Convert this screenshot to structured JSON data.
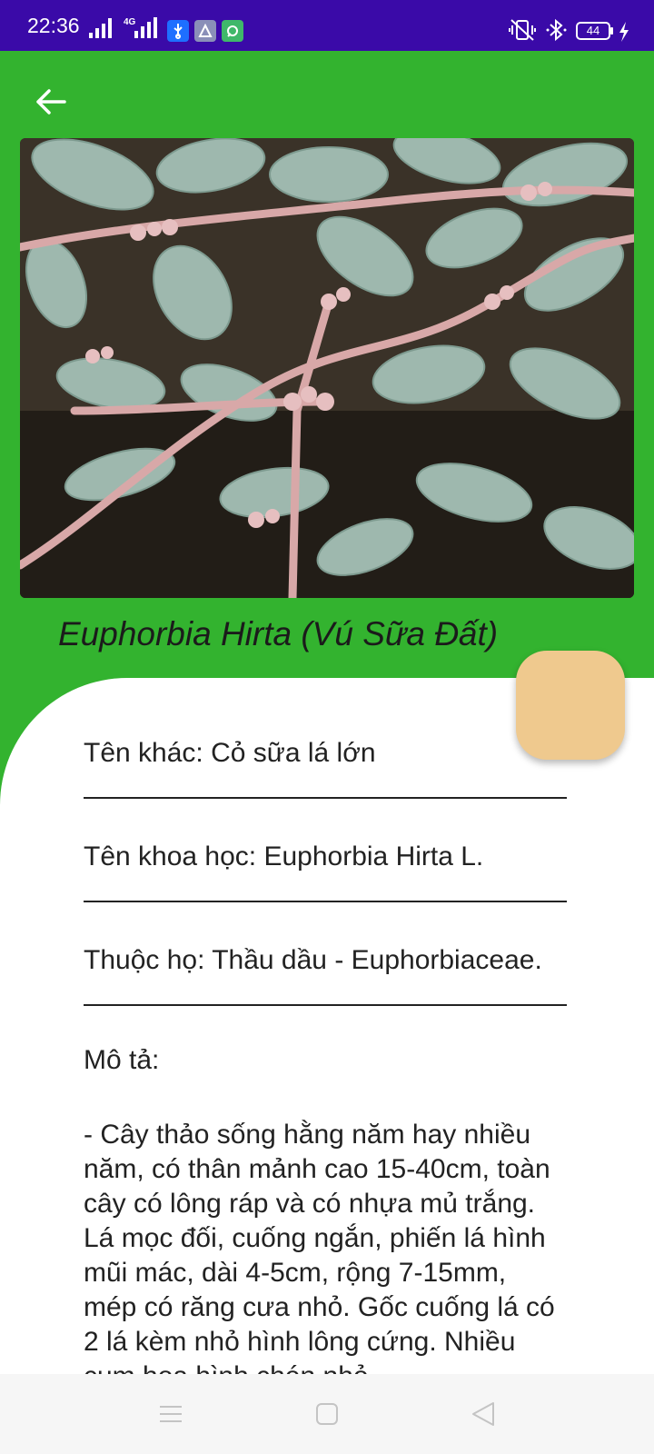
{
  "status_bar": {
    "time": "22:36",
    "network_label": "4G",
    "battery_level": "44",
    "colors": {
      "background": "#3a0aa8",
      "usb_badge": "#1e6fff",
      "app_badge_1": "#8a8fb8",
      "app_badge_2": "#3fb86a"
    },
    "icons": [
      "signal-icon",
      "signal-4g-icon",
      "usb-icon",
      "app-icon",
      "app-icon",
      "vibrate-icon",
      "bluetooth-icon",
      "battery-icon",
      "charging-icon"
    ]
  },
  "header": {
    "back_icon": "arrow-left-icon",
    "plant_title": "Euphorbia Hirta (Vú Sữa Đất)",
    "colors": {
      "background": "#33b32f"
    }
  },
  "details": {
    "other_name": "Tên khác: Cỏ sữa lá lớn",
    "scientific_name": "Tên khoa học: Euphorbia Hirta L.",
    "family": "Thuộc họ: Thầu dầu - Euphorbiaceae.",
    "description_label": "Mô tả:",
    "description_text": "- Cây thảo sống hằng năm hay nhiều năm, có thân mảnh cao 15-40cm, toàn cây có lông ráp và có nhựa mủ trắng. Lá mọc đối, cuống ngắn, phiến lá hình mũi mác, dài 4-5cm, rộng 7-15mm, mép có răng cưa nhỏ. Gốc cuống lá có 2 lá kèm nhỏ hình lông cứng. Nhiều cụm hoa hình chén nhỏ"
  },
  "fab": {
    "color": "#efc98e"
  },
  "nav_bar": {
    "icons": [
      "menu-icon",
      "home-square-icon",
      "back-triangle-icon"
    ]
  }
}
